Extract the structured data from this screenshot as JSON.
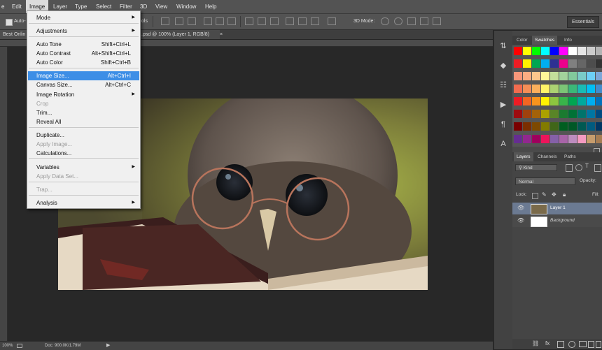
{
  "menubar": {
    "items": [
      "e",
      "Edit",
      "Image",
      "Layer",
      "Type",
      "Select",
      "Filter",
      "3D",
      "View",
      "Window",
      "Help"
    ]
  },
  "optionsbar": {
    "auto_label": "Auto-",
    "ols_label": "ols",
    "mode3d_label": "3D Mode:",
    "essentials": "Essentials"
  },
  "document": {
    "tab_left": "Best Onlin",
    "tab_title": ".psd @ 100% (Layer 1, RGB/8)",
    "tab_close": "×"
  },
  "status": {
    "zoom": "100%",
    "doc": "Doc: 900.0K/1.79M"
  },
  "image_menu": {
    "items": [
      {
        "label": "Mode",
        "shortcut": "",
        "submenu": true,
        "disabled": false
      },
      {
        "label": "Adjustments",
        "shortcut": "",
        "submenu": true,
        "disabled": false
      },
      {
        "label": "Auto Tone",
        "shortcut": "Shift+Ctrl+L",
        "submenu": false,
        "disabled": false
      },
      {
        "label": "Auto Contrast",
        "shortcut": "Alt+Shift+Ctrl+L",
        "submenu": false,
        "disabled": false
      },
      {
        "label": "Auto Color",
        "shortcut": "Shift+Ctrl+B",
        "submenu": false,
        "disabled": false
      },
      {
        "label": "Image Size...",
        "shortcut": "Alt+Ctrl+I",
        "submenu": false,
        "disabled": false,
        "highlighted": true
      },
      {
        "label": "Canvas Size...",
        "shortcut": "Alt+Ctrl+C",
        "submenu": false,
        "disabled": false
      },
      {
        "label": "Image Rotation",
        "shortcut": "",
        "submenu": true,
        "disabled": false
      },
      {
        "label": "Crop",
        "shortcut": "",
        "submenu": false,
        "disabled": true
      },
      {
        "label": "Trim...",
        "shortcut": "",
        "submenu": false,
        "disabled": false
      },
      {
        "label": "Reveal All",
        "shortcut": "",
        "submenu": false,
        "disabled": false
      },
      {
        "label": "Duplicate...",
        "shortcut": "",
        "submenu": false,
        "disabled": false
      },
      {
        "label": "Apply Image...",
        "shortcut": "",
        "submenu": false,
        "disabled": true
      },
      {
        "label": "Calculations...",
        "shortcut": "",
        "submenu": false,
        "disabled": false
      },
      {
        "label": "Variables",
        "shortcut": "",
        "submenu": true,
        "disabled": false
      },
      {
        "label": "Apply Data Set...",
        "shortcut": "",
        "submenu": false,
        "disabled": true
      },
      {
        "label": "Trap...",
        "shortcut": "",
        "submenu": false,
        "disabled": true
      },
      {
        "label": "Analysis",
        "shortcut": "",
        "submenu": true,
        "disabled": false
      }
    ]
  },
  "color_panel": {
    "tabs": [
      "Color",
      "Swatches",
      "Info"
    ],
    "swatch_rows": [
      [
        "#ff0000",
        "#ffff00",
        "#00ff00",
        "#00ffff",
        "#0000ff",
        "#ff00ff",
        "#ffffff",
        "#e6e6e6",
        "#cccccc",
        "#b3b3b3",
        "#999999"
      ],
      [
        "#ee1c24",
        "#fff200",
        "#00a651",
        "#00aeef",
        "#2e3192",
        "#ec008c",
        "#808080",
        "#666666",
        "#4d4d4d",
        "#333333",
        "#000000"
      ],
      [
        "#f7977a",
        "#fbad82",
        "#fdc68c",
        "#fff799",
        "#c4df9b",
        "#a3d39c",
        "#82ca9c",
        "#7accc8",
        "#6dcff6",
        "#7da7d8",
        "#8493ca"
      ],
      [
        "#f26c4f",
        "#f68e56",
        "#fbaf5c",
        "#fff467",
        "#acd372",
        "#7cc576",
        "#3bb878",
        "#1abbb4",
        "#00bff3",
        "#438ccb",
        "#5574b9"
      ],
      [
        "#ed1c24",
        "#f26522",
        "#f7941d",
        "#fff200",
        "#8dc63f",
        "#39b54a",
        "#00a651",
        "#00a99d",
        "#00aeef",
        "#0072bc",
        "#0054a6"
      ],
      [
        "#9e0b0f",
        "#a0410d",
        "#a36209",
        "#aba000",
        "#598527",
        "#1a7b30",
        "#007236",
        "#00746b",
        "#0076a3",
        "#004a80",
        "#003471"
      ],
      [
        "#790000",
        "#7b2e00",
        "#7d4900",
        "#827b00",
        "#406618",
        "#005e20",
        "#005826",
        "#005952",
        "#005b7f",
        "#003663",
        "#002157"
      ],
      [
        "#662d91",
        "#92278f",
        "#9e005d",
        "#ed145b",
        "#8560a8",
        "#a864a8",
        "#bd8cbf",
        "#f49ac1",
        "#c69c6d",
        "#a67c52",
        "#8c6239"
      ]
    ]
  },
  "layers_panel": {
    "tabs": [
      "Layers",
      "Channels",
      "Paths"
    ],
    "filter_label": "Kind",
    "blend_mode": "Normal",
    "opacity_label": "Opacity:",
    "lock_label": "Lock:",
    "fill_label": "Fill:",
    "layers": [
      {
        "name": "Layer 1",
        "selected": true
      },
      {
        "name": "Background",
        "selected": false
      }
    ]
  }
}
